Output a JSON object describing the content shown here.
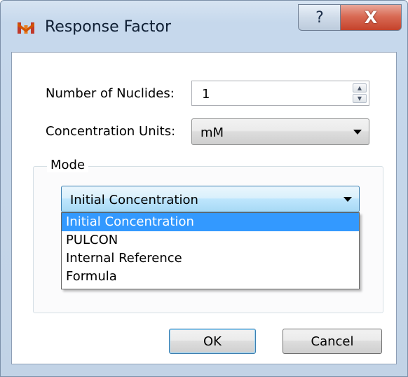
{
  "window": {
    "title": "Response Factor",
    "app_icon": "molecule-icon",
    "help_label": "?",
    "close_label": "X"
  },
  "form": {
    "nuclides_label": "Number of Nuclides:",
    "nuclides_value": "1",
    "units_label": "Concentration Units:",
    "units_value": "mM",
    "mode_label": "Mode",
    "mode_value": "Initial Concentration",
    "mode_options": [
      {
        "label": "Initial Concentration",
        "selected": true
      },
      {
        "label": "PULCON",
        "selected": false
      },
      {
        "label": "Internal Reference",
        "selected": false
      },
      {
        "label": "Formula",
        "selected": false
      }
    ]
  },
  "buttons": {
    "ok": "OK",
    "cancel": "Cancel"
  },
  "colors": {
    "selection": "#3399ff",
    "close_button": "#c4422b"
  }
}
